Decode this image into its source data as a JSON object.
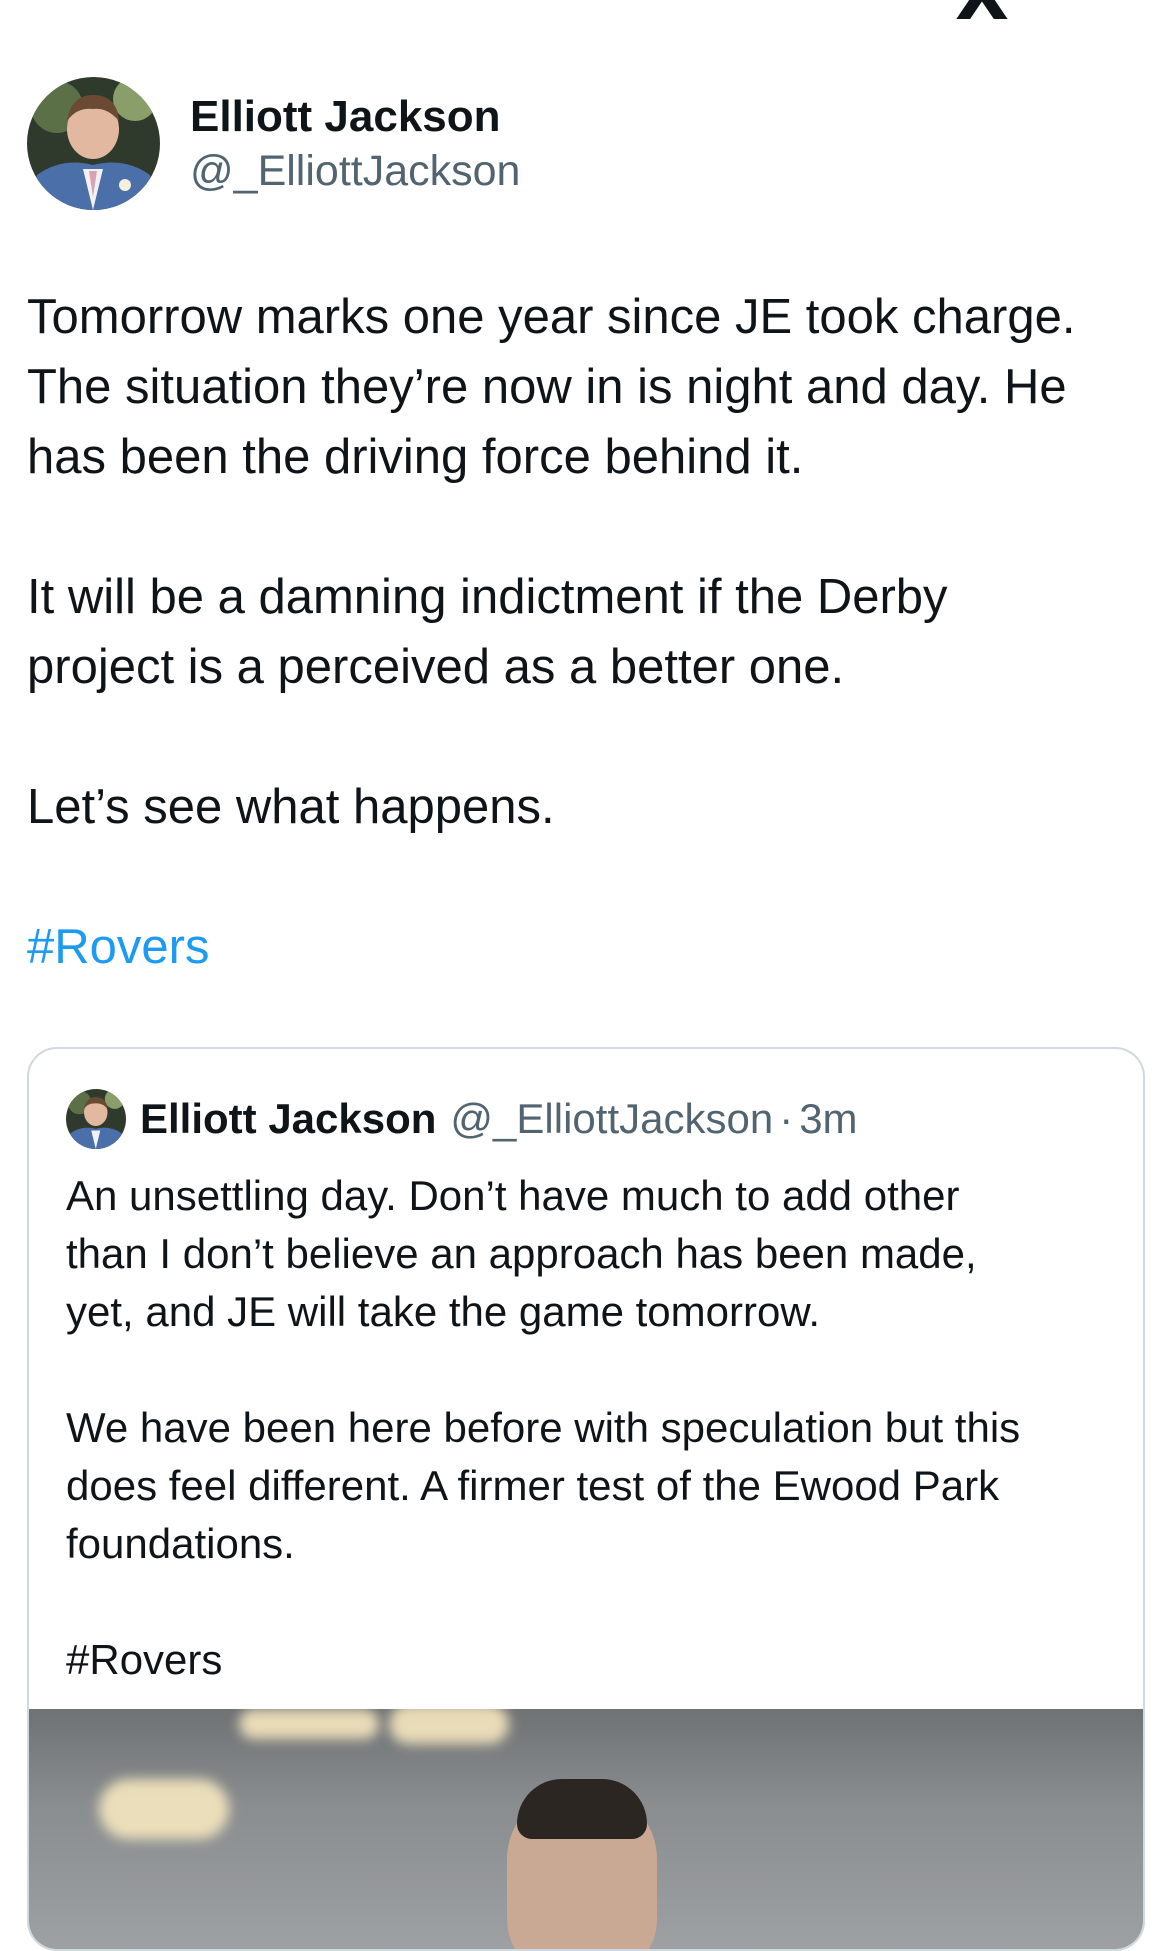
{
  "tweet": {
    "author_name": "Elliott Jackson",
    "author_handle": "@_ElliottJackson",
    "paragraphs": [
      "Tomorrow marks one year since JE took charge.\nThe situation they’re now in is night and day. He\nhas been the driving force behind it.",
      "It will be a damning indictment if the Derby\nproject is a perceived as a better one.",
      "Let’s see what happens."
    ],
    "hashtag": "#Rovers",
    "hashtag_color": "#1d9bf0"
  },
  "quote": {
    "author_name": "Elliott Jackson",
    "author_handle": "@_ElliottJackson",
    "separator": "·",
    "time": "3m",
    "paragraphs": [
      "An unsettling day. Don’t have much to add other\nthan I don’t believe an approach has been made,\nyet, and JE will take the game tomorrow.",
      "We have been here before with speculation but this\ndoes feel different. A firmer test of the Ewood Park\nfoundations.",
      "#Rovers"
    ]
  },
  "icons": {
    "corner_logo": "x-logo-icon",
    "avatar": "profile-photo-avatar",
    "quote_media": "photo-of-manager"
  },
  "colors": {
    "text": "#0f1419",
    "secondary": "#536471",
    "border": "#cfd9de"
  }
}
